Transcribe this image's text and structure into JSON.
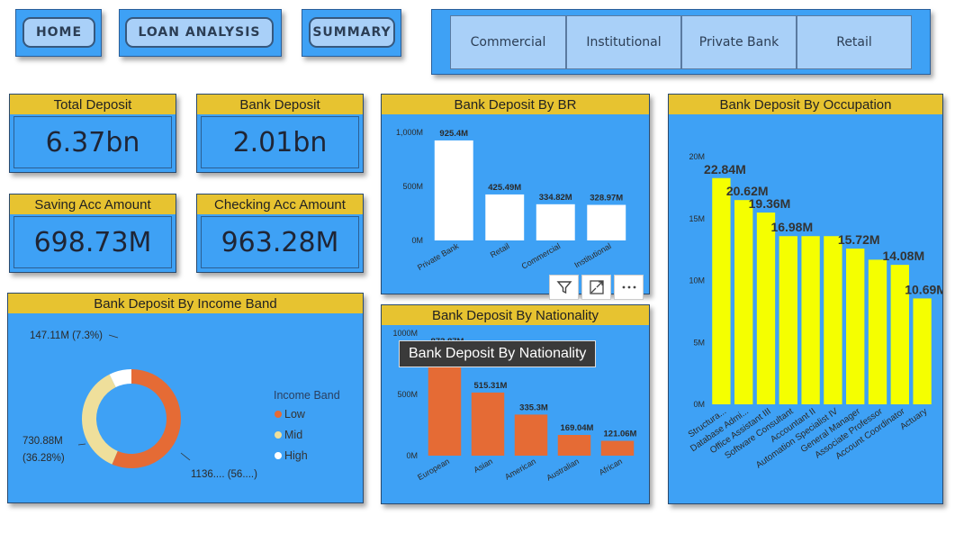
{
  "nav": {
    "home": "HOME",
    "loan": "LOAN ANALYSIS",
    "summary": "SUMMARY"
  },
  "slicer": {
    "items": [
      "Commercial",
      "Institutional",
      "Private Bank",
      "Retail"
    ]
  },
  "kpis": {
    "total_deposit": {
      "label": "Total Deposit",
      "value": "6.37bn"
    },
    "bank_deposit": {
      "label": "Bank Deposit",
      "value": "2.01bn"
    },
    "saving": {
      "label": "Saving Acc Amount",
      "value": "698.73M"
    },
    "checking": {
      "label": "Checking Acc Amount",
      "value": "963.28M"
    }
  },
  "tooltip": "Bank Deposit By Nationality",
  "colors": {
    "panel": "#3ea1f5",
    "title": "#e7c330",
    "bar_white": "#ffffff",
    "bar_orange": "#e56b35",
    "bar_yellow": "#f5ff00",
    "donut_low": "#e56b35",
    "donut_mid": "#efdf9b",
    "donut_high": "#ffffff"
  },
  "chart_data": [
    {
      "id": "by_br",
      "type": "bar",
      "title": "Bank Deposit By BR",
      "categories": [
        "Private Bank",
        "Retail",
        "Commercial",
        "Institutional"
      ],
      "values": [
        925.4,
        425.49,
        334.82,
        328.97
      ],
      "labels": [
        "925.4M",
        "425.49M",
        "334.82M",
        "328.97M"
      ],
      "yticks": [
        "0M",
        "500M",
        "1,000M"
      ],
      "ylim": [
        0,
        1000
      ]
    },
    {
      "id": "by_nationality",
      "type": "bar",
      "title": "Bank Deposit By Nationality",
      "categories": [
        "European",
        "Asian",
        "American",
        "Australian",
        "African"
      ],
      "values": [
        873.87,
        515.31,
        335.3,
        169.04,
        121.06
      ],
      "labels": [
        "873.87M",
        "515.31M",
        "335.3M",
        "169.04M",
        "121.06M"
      ],
      "yticks": [
        "0M",
        "500M",
        "1000M"
      ],
      "ylim": [
        0,
        1000
      ]
    },
    {
      "id": "by_occupation",
      "type": "bar",
      "title": "Bank Deposit By Occupation",
      "categories": [
        "Structura...",
        "Database Admi...",
        "Office Assistant III",
        "Software Consultant",
        "Accountant II",
        "Automation Specialist IV",
        "General Manager",
        "Associate Professor",
        "Account Coordinator",
        "Actuary"
      ],
      "values": [
        22.84,
        20.62,
        19.36,
        16.98,
        16.98,
        16.98,
        15.72,
        14.6,
        14.08,
        10.69
      ],
      "labels": [
        "22.84M",
        "20.62M",
        "19.36M",
        "16.98M",
        "",
        "",
        "15.72M",
        "",
        "14.08M",
        "10.69M"
      ],
      "yticks": [
        "0M",
        "5M",
        "10M",
        "15M",
        "20M"
      ],
      "ylim": [
        0,
        25
      ]
    },
    {
      "id": "by_income_band",
      "type": "pie",
      "title": "Bank Deposit By Income Band",
      "legend_title": "Income Band",
      "categories": [
        "Low",
        "Mid",
        "High"
      ],
      "values": [
        1136,
        730.88,
        147.11
      ],
      "labels": [
        "1136.... (56....)",
        "730.88M (36.28%)",
        "147.11M (7.3%)"
      ]
    }
  ]
}
